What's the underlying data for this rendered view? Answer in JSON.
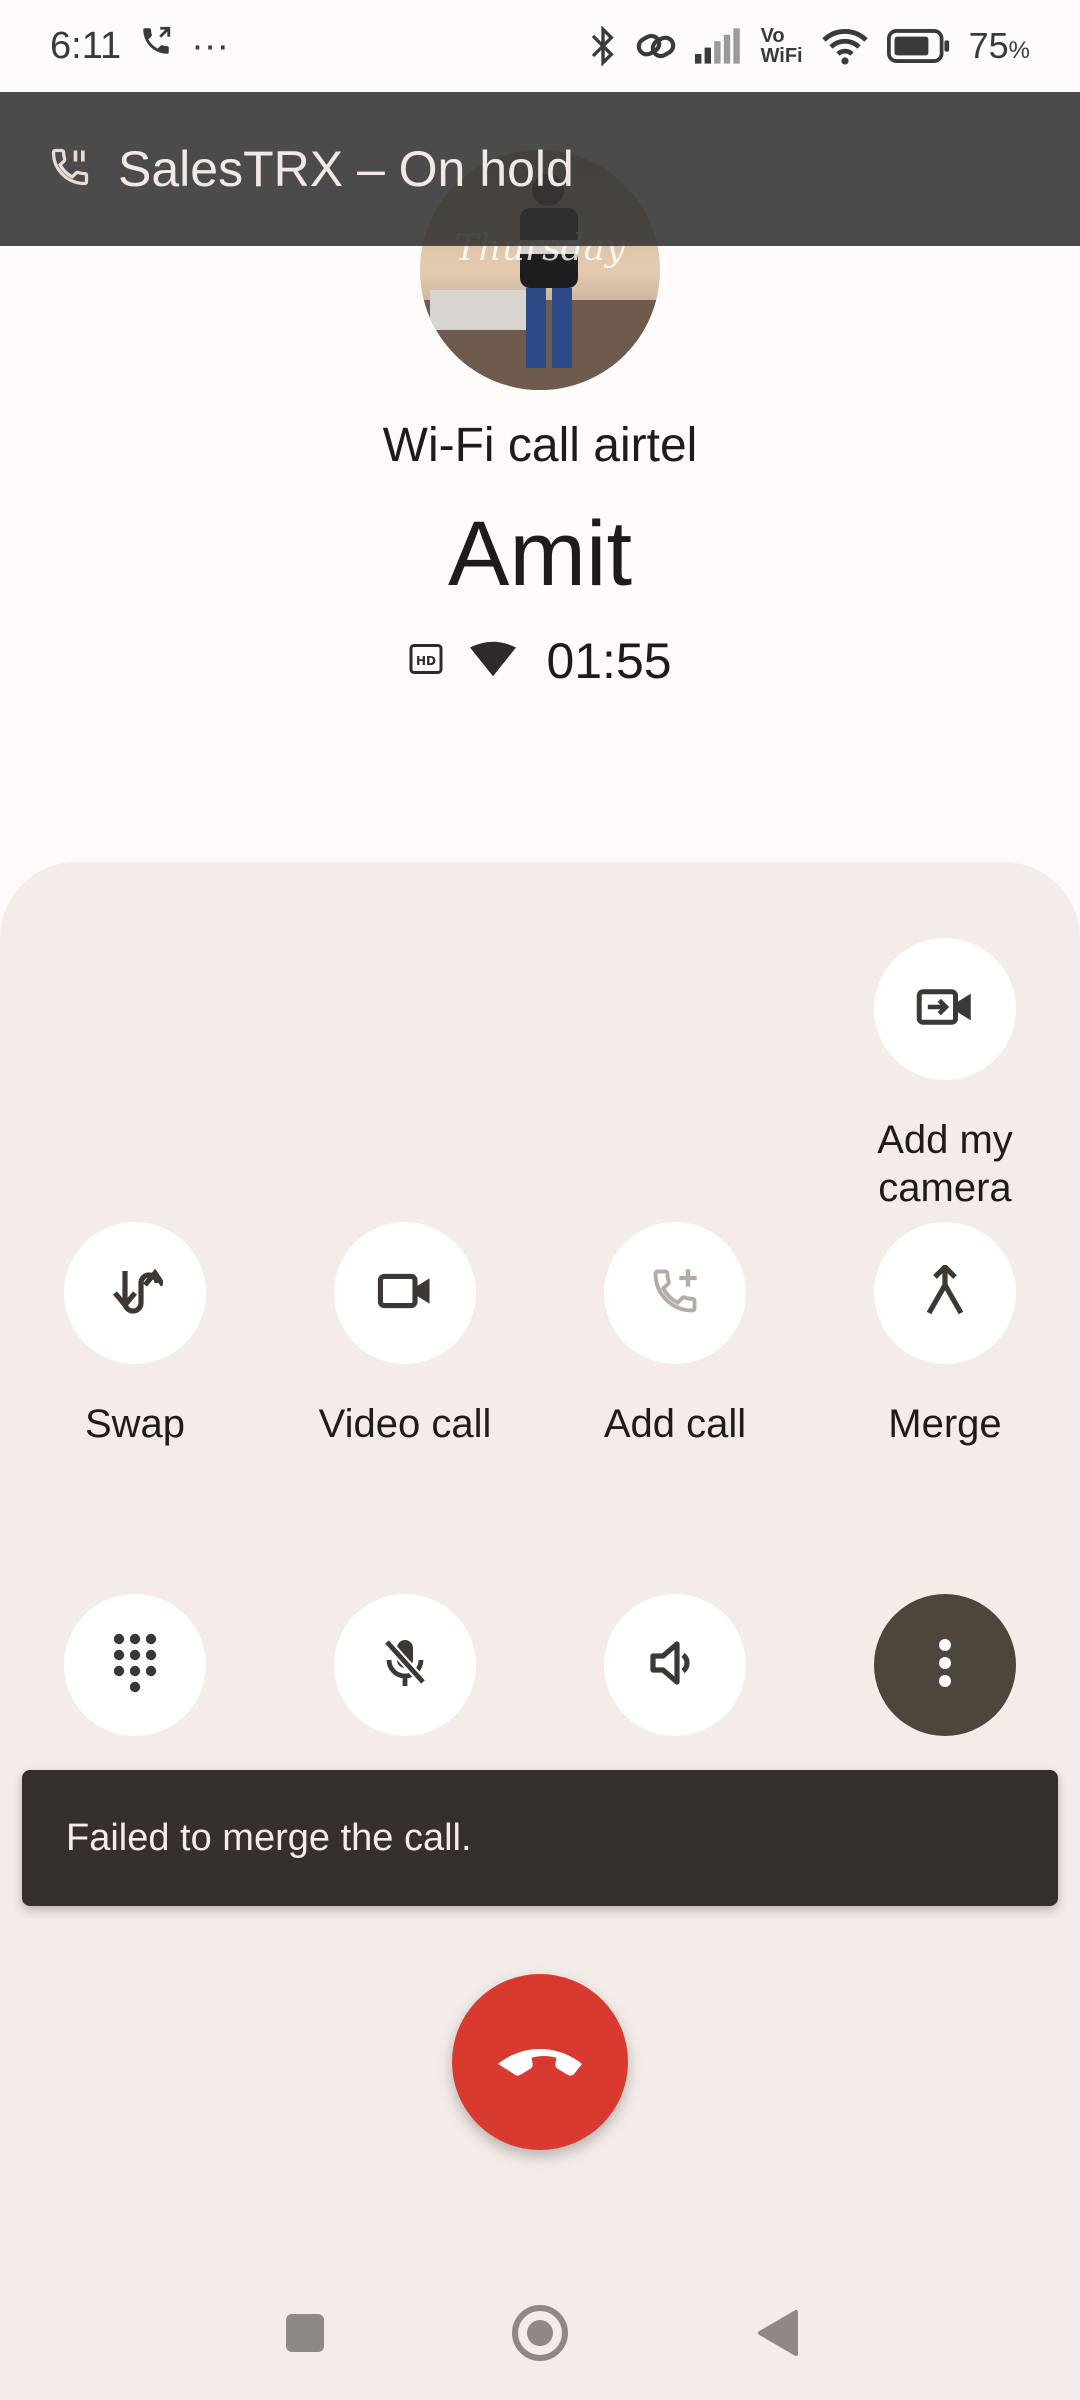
{
  "status_bar": {
    "time": "6:11",
    "more": "···",
    "battery": "75",
    "battery_unit": "%",
    "icons": [
      "phone-call-icon",
      "bluetooth-icon",
      "link-icon",
      "signal-icon",
      "vowifi-icon",
      "wifi-icon",
      "battery-icon"
    ],
    "vowifi_top": "Vo",
    "vowifi_bottom": "WiFi"
  },
  "hold_banner": {
    "text": "SalesTRX – On hold",
    "icon": "phone-hold-icon"
  },
  "call": {
    "type": "Wi-Fi call airtel",
    "name": "Amit",
    "hd_label": "HD",
    "timer": "01:55"
  },
  "controls": {
    "add_camera": "Add my camera",
    "add_camera_line1": "Add my",
    "add_camera_line2": "camera",
    "swap": "Swap",
    "video_call": "Video call",
    "add_call": "Add call",
    "merge": "Merge"
  },
  "toast": {
    "message": "Failed to merge the call."
  },
  "colors": {
    "panel": "#f3ece9",
    "end_call": "#d93a2f",
    "more_button": "#4c463d",
    "toast": "#35302c"
  }
}
